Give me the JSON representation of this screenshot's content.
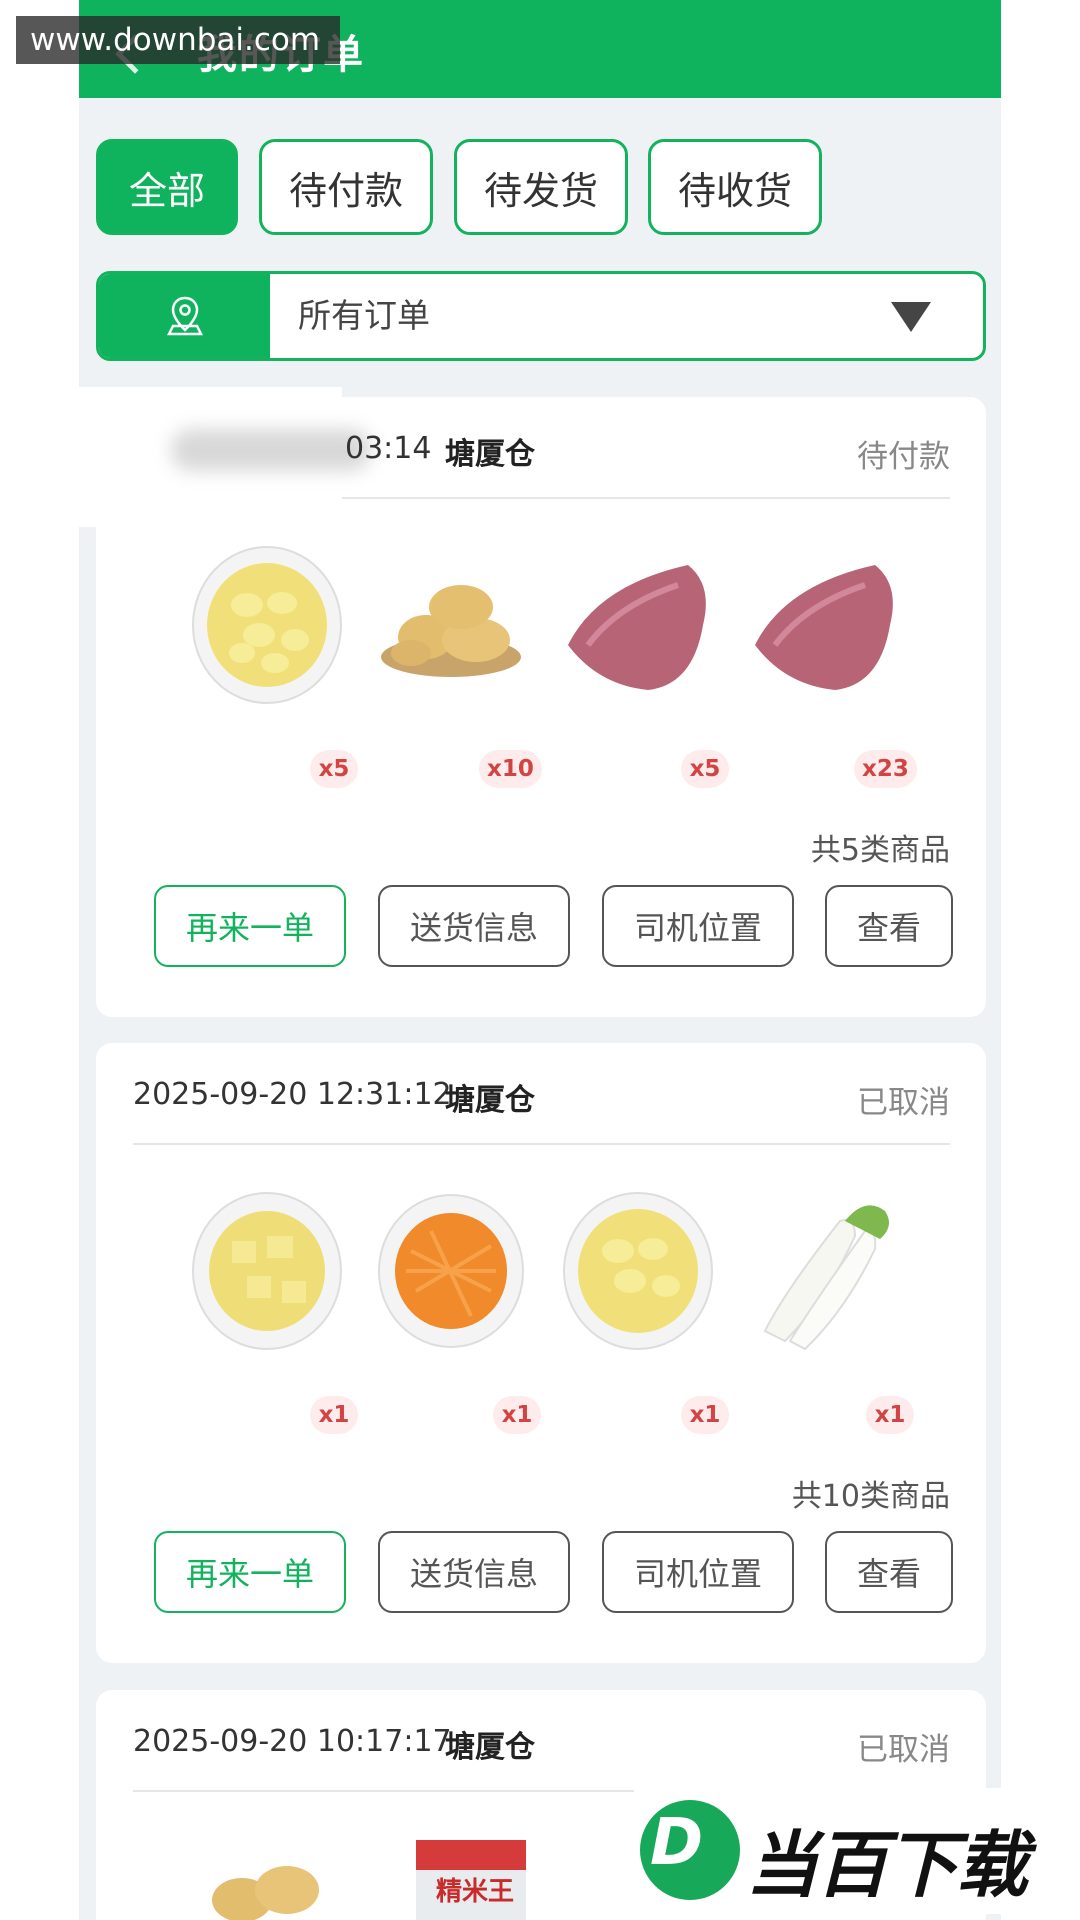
{
  "header": {
    "title": "我的订单",
    "watermark": "www.downbai.com"
  },
  "tabs": [
    {
      "label": "全部"
    },
    {
      "label": "待付款"
    },
    {
      "label": "待发货"
    },
    {
      "label": "待收货"
    }
  ],
  "filter": {
    "value": "所有订单",
    "icon": "location-pin-icon",
    "dropdown_icon": "triangle-down-icon"
  },
  "orders": [
    {
      "datetime": "03:14",
      "warehouse": "塘厦仓",
      "status": "待付款",
      "items": [
        {
          "name": "potato-slices",
          "qty": "x5"
        },
        {
          "name": "potatoes",
          "qty": "x10"
        },
        {
          "name": "pork",
          "qty": "x5"
        },
        {
          "name": "pork",
          "qty": "x23"
        }
      ],
      "total": "共5类商品"
    },
    {
      "datetime": "2025-09-20 12:31:12",
      "warehouse": "塘厦仓",
      "status": "已取消",
      "items": [
        {
          "name": "potato-cubes",
          "qty": "x1"
        },
        {
          "name": "carrot-shreds",
          "qty": "x1"
        },
        {
          "name": "potato-slices",
          "qty": "x1"
        },
        {
          "name": "white-radish",
          "qty": "x1"
        }
      ],
      "total": "共10类商品"
    },
    {
      "datetime": "2025-09-20 10:17:17",
      "warehouse": "塘厦仓",
      "status": "已取消",
      "items": [
        {
          "name": "potatoes"
        },
        {
          "name": "rice-bag",
          "brand": "精米王"
        }
      ]
    }
  ],
  "buttons": {
    "reorder": "再来一单",
    "delivery": "送货信息",
    "driver": "司机位置",
    "view": "查看"
  },
  "brand_logo": {
    "letter": "D",
    "text": "当百下载"
  },
  "colors": {
    "primary": "#0fb35d",
    "qty_bg": "#fdeceb",
    "qty_text": "#d24444",
    "page_bg": "#eef2f5"
  }
}
